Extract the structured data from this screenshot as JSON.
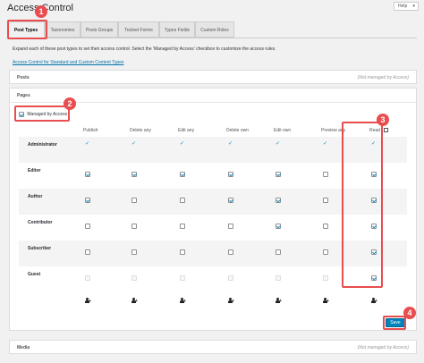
{
  "page": {
    "title": "Access Control",
    "help_label": "Help"
  },
  "tabs": [
    {
      "label": "Post Types",
      "active": true
    },
    {
      "label": "Taxonomies",
      "active": false
    },
    {
      "label": "Posts Groups",
      "active": false
    },
    {
      "label": "Toolset Forms",
      "active": false
    },
    {
      "label": "Types Fields",
      "active": false
    },
    {
      "label": "Custom Roles",
      "active": false
    }
  ],
  "intro": {
    "text": "Expand each of these post types to set their access control. Select the 'Managed by Access' checkbox to customize the access rules.",
    "link": "Access Control for Standard and Custom Content Types"
  },
  "posts_panel": {
    "title": "Posts",
    "status": "(Not managed by Access)"
  },
  "pages_panel": {
    "title": "Pages",
    "managed_label": "Managed by Access",
    "managed_checked": true,
    "columns": [
      "Publish",
      "Delete any",
      "Edit any",
      "Delete own",
      "Edit own",
      "Preview any",
      "Read"
    ],
    "roles": [
      {
        "name": "Administrator",
        "perms": [
          "check",
          "check",
          "check",
          "check",
          "check",
          "check",
          "check"
        ]
      },
      {
        "name": "Editor",
        "perms": [
          "on",
          "on",
          "on",
          "on",
          "on",
          "off",
          "on"
        ]
      },
      {
        "name": "Author",
        "perms": [
          "on",
          "off",
          "off",
          "on",
          "on",
          "off",
          "on"
        ]
      },
      {
        "name": "Contributor",
        "perms": [
          "off",
          "off",
          "off",
          "off",
          "on",
          "off",
          "on"
        ]
      },
      {
        "name": "Subscriber",
        "perms": [
          "off",
          "off",
          "off",
          "off",
          "off",
          "off",
          "on"
        ]
      },
      {
        "name": "Guest",
        "perms": [
          "disabled",
          "disabled",
          "disabled",
          "disabled",
          "disabled",
          "disabled",
          "on"
        ]
      }
    ]
  },
  "save_label": "Save",
  "media_panel": {
    "title": "Media",
    "status": "(Not managed by Access)"
  },
  "callouts": [
    "1",
    "2",
    "3",
    "4"
  ],
  "colors": {
    "accent": "#0085ba",
    "callout": "#e84d4f",
    "check": "#1e8cbe"
  }
}
